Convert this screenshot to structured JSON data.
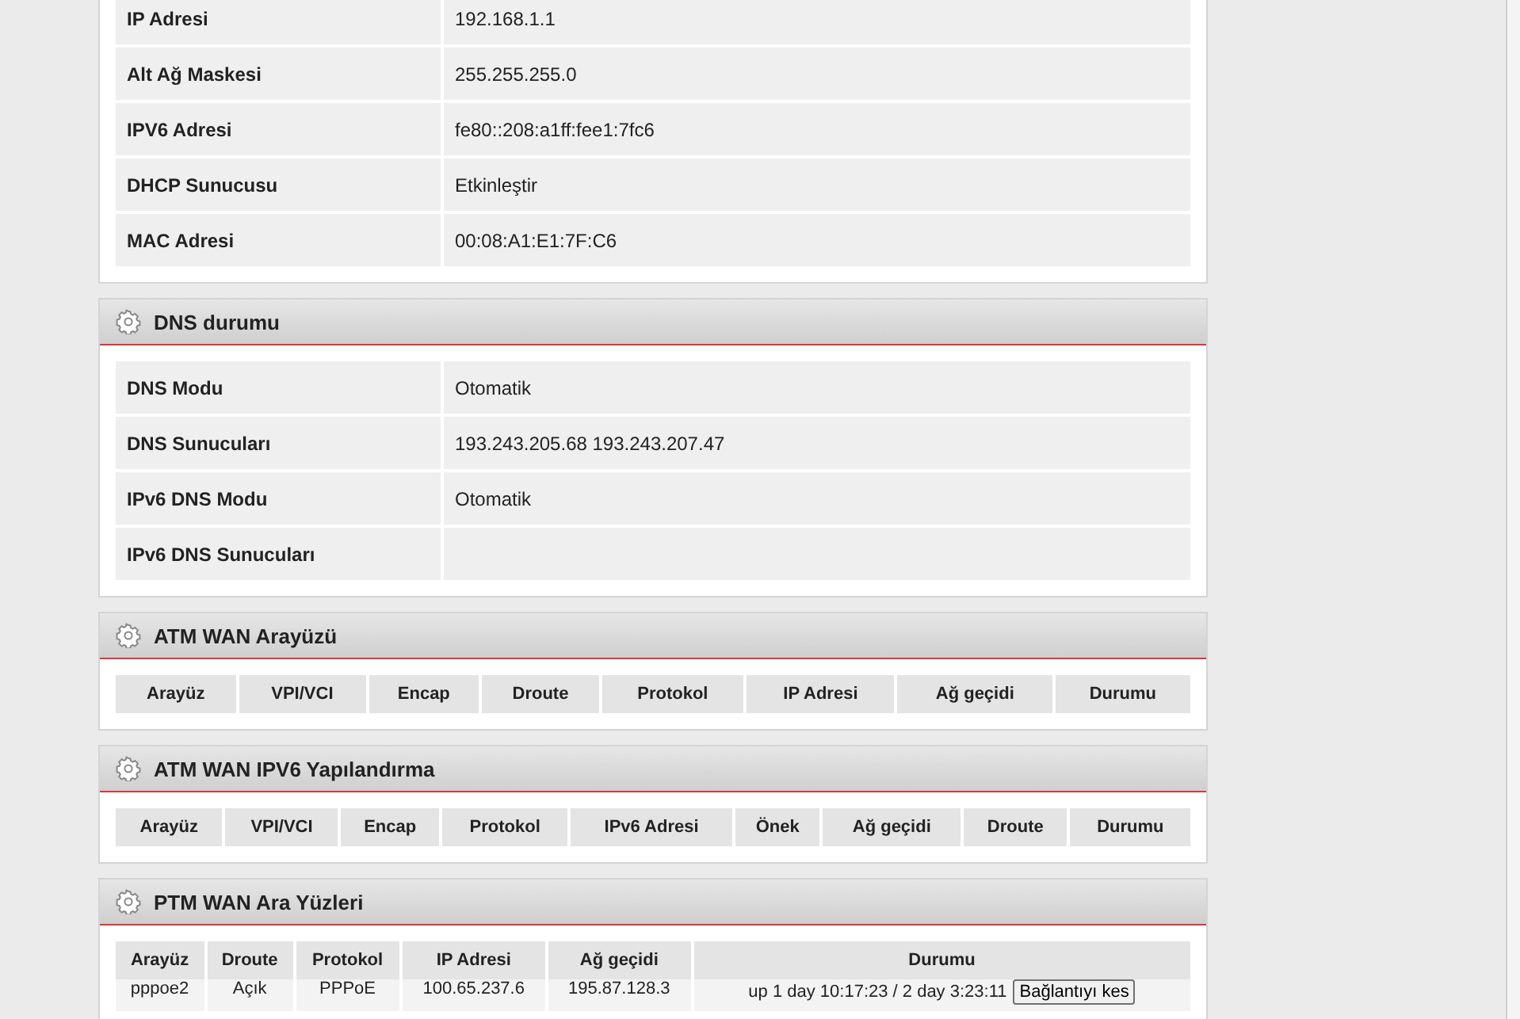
{
  "lan_info": {
    "rows": [
      {
        "label": "IP Adresi",
        "value": "192.168.1.1"
      },
      {
        "label": "Alt Ağ Maskesi",
        "value": "255.255.255.0"
      },
      {
        "label": "IPV6 Adresi",
        "value": "fe80::208:a1ff:fee1:7fc6"
      },
      {
        "label": "DHCP Sunucusu",
        "value": "Etkinleştir"
      },
      {
        "label": "MAC Adresi",
        "value": "00:08:A1:E1:7F:C6"
      }
    ]
  },
  "dns_status": {
    "title": "DNS durumu",
    "rows": [
      {
        "label": "DNS Modu",
        "value": "Otomatik"
      },
      {
        "label": "DNS Sunucuları",
        "value": "193.243.205.68 193.243.207.47"
      },
      {
        "label": "IPv6 DNS Modu",
        "value": "Otomatik"
      },
      {
        "label": "IPv6 DNS Sunucuları"
      }
    ]
  },
  "atm_wan": {
    "title": "ATM WAN Arayüzü",
    "columns": [
      "Arayüz",
      "VPI/VCI",
      "Encap",
      "Droute",
      "Protokol",
      "IP Adresi",
      "Ağ geçidi",
      "Durumu"
    ]
  },
  "atm_wan_ipv6": {
    "title": "ATM WAN IPV6 Yapılandırma",
    "columns": [
      "Arayüz",
      "VPI/VCI",
      "Encap",
      "Protokol",
      "IPv6 Adresi",
      "Önek",
      "Ağ geçidi",
      "Droute",
      "Durumu"
    ]
  },
  "ptm_wan": {
    "title": "PTM WAN Ara Yüzleri",
    "columns": [
      "Arayüz",
      "Droute",
      "Protokol",
      "IP Adresi",
      "Ağ geçidi",
      "Durumu"
    ],
    "rows": [
      {
        "cells": [
          "pppoe2",
          "Açık",
          "PPPoE",
          "100.65.237.6",
          "195.87.128.3"
        ],
        "status": "up 1 day 10:17:23 / 2 day 3:23:11",
        "action": "Bağlantıyı kes"
      }
    ]
  }
}
